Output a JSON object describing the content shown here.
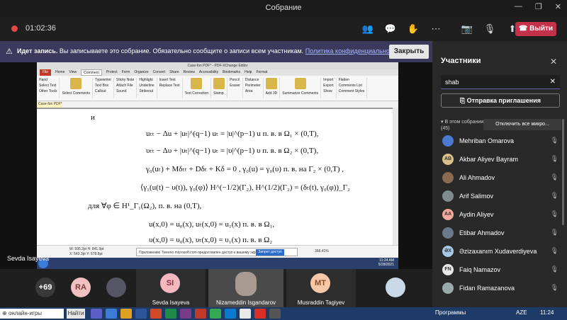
{
  "window": {
    "title": "Собрание"
  },
  "toolbar": {
    "elapsed": "01:02:36",
    "leave_label": "Выйти"
  },
  "recording_banner": {
    "title": "Идет запись.",
    "message": "Вы записываете это собрание. Обязательно сообщите о записи всем участникам.",
    "link": "Политика конфиденциальности",
    "close_label": "Закрыть"
  },
  "shared_screen": {
    "app_title": "Case-fon PDF* - PDF-XChange Editor",
    "menu_tabs": [
      "File",
      "Home",
      "View",
      "Comment",
      "Protect",
      "Form",
      "Organize",
      "Convert",
      "Share",
      "Review",
      "Accessibility",
      "Bookmarks",
      "Help",
      "Format"
    ],
    "ribbon_groups": [
      [
        "Hand",
        "Select Text",
        "Other Tools"
      ],
      [
        "Select Comments"
      ],
      [
        "Typewriter",
        "Text Box",
        "Callout"
      ],
      [
        "Sticky Note",
        "Attach File",
        "Sound"
      ],
      [
        "Highlight",
        "Underline",
        "Strikeout"
      ],
      [
        "Insert Text",
        "Replace Text"
      ],
      [
        "Text Correction"
      ],
      [
        "Stamp"
      ],
      [
        "Pencil",
        "Eraser"
      ],
      [
        "Distance",
        "Perimeter",
        "Area"
      ],
      [
        "Add 3D"
      ],
      [
        "Summarize Comments"
      ],
      [
        "Import",
        "Export",
        "Show"
      ],
      [
        "Flatten",
        "Comments List",
        "Comment Styles"
      ]
    ],
    "doc_tab": "Case-fon PDF*",
    "page_text": {
      "line0": "и",
      "line1": "uₜₜ − Δu + |uₜ|^(q−1) uₜ = |u|^(p−1) u   п. в. в  Ω₁ × (0,T),",
      "line2": "υₜₜ − Δυ + |υₜ|^(q−1) υₜ = |υ|^(p−1) υ   п. в. в   Ω₂ × (0,T),",
      "line3": "γ₀(uₜ) + Mδₜₜ + Dδₜ + Kδ = 0 , γ₀(u) = γ₀(υ)  п. в. на  Γ₂ × (0,T) ,",
      "line4": "⟨γ₁(u(t) − υ(t)), γ₀(φ)⟩ H^(−1/2)(Γ₂), H^(1/2)(Γ₂) = (δₜ(t), γ₀(φ))_Γ₂",
      "line5": "для ∀φ ∈ H¹_Γ₁(Ω₂), п. в. на (0,T),",
      "line6": "u(x,0) = u₀(x),  uₜ(x,0) = u₁(x)   п. в. в  Ω₁,",
      "line7": "υ(x,0) = υ₀(x),  υₜ(x,0) = υ₁(x)   п. в. в  Ω₂"
    },
    "status": {
      "size": "W: 595.2pt  H: 841.9pt",
      "coords": "X: 543.3pt  Y: 578.8pt",
      "zoom": "368.41%",
      "notice": "Приложению Tweeno microsoft.com предоставлен доступ к вашему экрану",
      "allow_label": "Запрет доступ",
      "clock_time": "11:24 AM",
      "clock_date": "5/28/2021"
    }
  },
  "presenter_name": "Sevda Isayeva",
  "gallery": {
    "overflow": "+69",
    "tiles": [
      {
        "initials": "RA",
        "name": ""
      },
      {
        "initials": "",
        "name": ""
      },
      {
        "initials": "SI",
        "name": "Sevda Isayeva"
      },
      {
        "initials": "",
        "name": "Nizameddin Isgandarov"
      },
      {
        "initials": "MT",
        "name": "Musraddin Tagiyev"
      },
      {
        "initials": "",
        "name": ""
      }
    ]
  },
  "participants_panel": {
    "title": "Участники",
    "search_value": "shab",
    "invite_label": "Отправка приглашения",
    "group_label": "В этом собрании",
    "group_count": "(45)",
    "mute_all_label": "Отключить все микро...",
    "people": [
      {
        "initials": "",
        "name": "Mehriban Omarova",
        "color": "#4a7bd0"
      },
      {
        "initials": "AB",
        "name": "Akbar Aliyev Bayram",
        "color": "#d9c08a"
      },
      {
        "initials": "",
        "name": "Ali Ahmadov",
        "color": "#8a6a50"
      },
      {
        "initials": "",
        "name": "Arif Salimov",
        "color": "#7f8c8d"
      },
      {
        "initials": "AA",
        "name": "Aydin Aliyev",
        "color": "#f2a89a"
      },
      {
        "initials": "",
        "name": "Etibar Ahmadov",
        "color": "#6b7a8a"
      },
      {
        "initials": "ƏX",
        "name": "Əzizaxanım Xudaverdiyeva",
        "color": "#a8c8e8"
      },
      {
        "initials": "FN",
        "name": "Faiq Namazov",
        "color": "#e8e8e8"
      },
      {
        "initials": "",
        "name": "Fidan Ramazanova",
        "color": "#9aa"
      }
    ]
  },
  "taskbar": {
    "search_placeholder": "онлайн-игры",
    "go_label": "Найти",
    "programs_label": "Программы",
    "lang": "AZE",
    "time": "11:24"
  },
  "colors": {
    "accent": "#6264a7",
    "leave": "#c4314b",
    "banner": "#3b3a5c"
  }
}
